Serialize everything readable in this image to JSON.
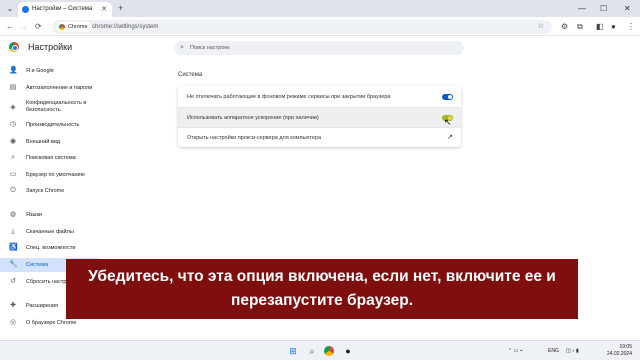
{
  "window": {
    "tab_title": "Настройки – Система",
    "new_tab": "+",
    "tab_menu": "⌄",
    "tab_close": "✕",
    "minimize": "—",
    "maximize": "☐",
    "close": "✕"
  },
  "toolbar": {
    "back": "←",
    "forward": "→",
    "reload": "⟳",
    "chip_label": "Chrome",
    "url": "chrome://settings/system",
    "icons": [
      "star-icon",
      "translate-icon",
      "extensions-icon",
      "side-panel-icon",
      "profile-icon",
      "menu-icon"
    ]
  },
  "header": {
    "title": "Настройки",
    "search_placeholder": "Поиск настроек"
  },
  "sidebar": {
    "items": [
      {
        "label": "Я и Google",
        "icon": "person-icon",
        "glyph": "👤"
      },
      {
        "label": "Автозаполнение и пароли",
        "icon": "clipboard-icon",
        "glyph": "▤"
      },
      {
        "label_1": "Конфиденциальность и",
        "label_2": "безопасность",
        "icon": "shield-icon",
        "glyph": "◈"
      },
      {
        "label": "Производительность",
        "icon": "speedometer-icon",
        "glyph": "◷"
      },
      {
        "label": "Внешний вид",
        "icon": "palette-icon",
        "glyph": "◉"
      },
      {
        "label": "Поисковая система",
        "icon": "search-icon",
        "glyph": "⌕"
      },
      {
        "label": "Браузер по умолчанию",
        "icon": "browser-icon",
        "glyph": "▭"
      },
      {
        "label": "Запуск Chrome",
        "icon": "power-icon",
        "glyph": "⏻"
      },
      {
        "label": "Языки",
        "icon": "globe-icon",
        "glyph": "◍"
      },
      {
        "label": "Скачанные файлы",
        "icon": "download-icon",
        "glyph": "⤓"
      },
      {
        "label": "Спец. возможности",
        "icon": "accessibility-icon",
        "glyph": "♿"
      },
      {
        "label": "Система",
        "icon": "wrench-icon",
        "glyph": "🔧"
      },
      {
        "label": "Сбросить настройки",
        "icon": "reset-icon",
        "glyph": "↺"
      },
      {
        "label": "Расширения",
        "icon": "puzzle-icon",
        "glyph": "✚"
      },
      {
        "label": "О браузере Chrome",
        "icon": "chrome-icon",
        "glyph": "◎"
      }
    ]
  },
  "main": {
    "section_title": "Система",
    "rows": [
      {
        "label": "Не отключать работающие в фоновом режиме сервисы при закрытии браузера",
        "toggle_on": true
      },
      {
        "label": "Использовать аппаратное ускорение (при наличии)",
        "toggle_on": true
      },
      {
        "label": "Открыть настройки прокси-сервера для компьютера",
        "ext_icon": "↗"
      }
    ]
  },
  "banner": {
    "line1": "Убедитесь, что эта опция включена, если нет, включите ее и",
    "line2": "перезапустите браузер."
  },
  "taskbar": {
    "lang": "ENG",
    "time": "19:05",
    "date": "24.02.2024"
  },
  "colors": {
    "accent": "#0b57d0",
    "banner": "#7f0e0e",
    "active_item": "#d3e3fd"
  }
}
